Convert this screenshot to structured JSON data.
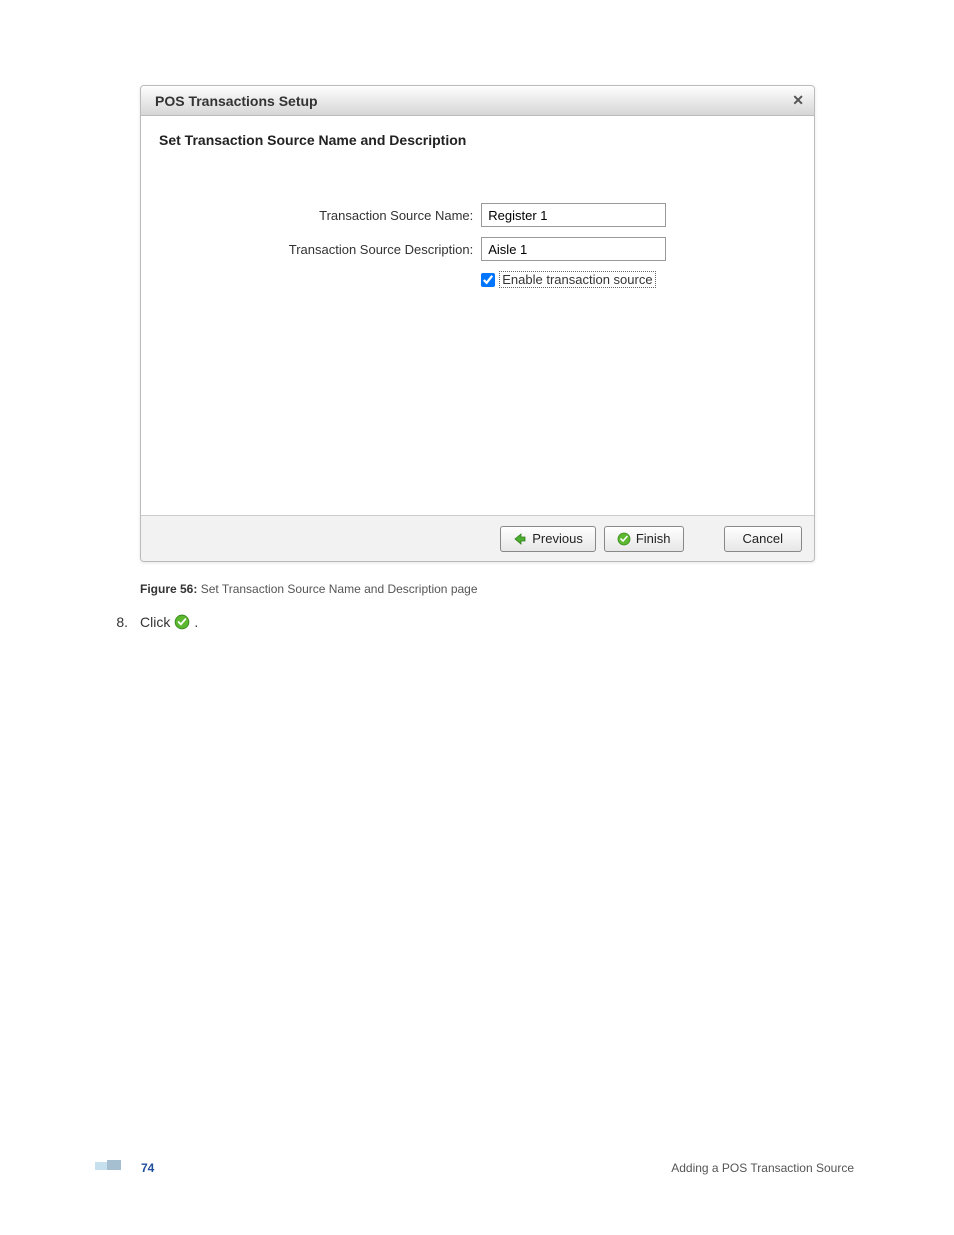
{
  "dialog": {
    "title": "POS Transactions Setup",
    "heading": "Set Transaction Source Name and Description",
    "fields": {
      "name_label": "Transaction Source Name:",
      "name_value": "Register 1",
      "desc_label": "Transaction Source Description:",
      "desc_value": "Aisle 1",
      "enable_label": "Enable transaction source",
      "enable_checked": true
    },
    "buttons": {
      "previous": "Previous",
      "finish": "Finish",
      "cancel": "Cancel"
    }
  },
  "caption": {
    "prefix": "Figure 56:",
    "text": " Set Transaction Source Name and Description page"
  },
  "step": {
    "number": "8.",
    "pre": "Click ",
    "post": "."
  },
  "footer": {
    "page_number": "74",
    "section": "Adding a POS Transaction Source"
  }
}
